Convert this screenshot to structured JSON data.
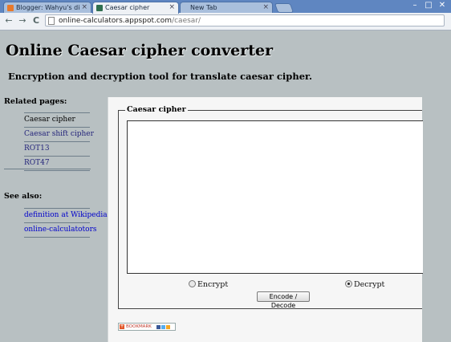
{
  "browser": {
    "tabs": [
      {
        "title": "Blogger: Wahyu's diary - I",
        "favicon_color": "#e8792b",
        "active": false
      },
      {
        "title": "Caesar cipher",
        "favicon_color": "#2f6f4f",
        "active": true
      },
      {
        "title": "New Tab",
        "favicon_color": "",
        "active": false
      }
    ],
    "tab_close_glyph": "×",
    "window_controls": {
      "minimize": "–",
      "maximize": "□",
      "close": "✕"
    },
    "nav": {
      "back": "←",
      "forward": "→",
      "reload": "C"
    },
    "url_host": "online-calculators.appspot.com",
    "url_path": "/caesar/"
  },
  "page": {
    "title": "Online Caesar cipher converter",
    "subtitle": "Encryption and decryption tool for translate caesar cipher."
  },
  "sidebar": {
    "related_heading": "Related pages:",
    "related_items": [
      {
        "label": "Caesar cipher"
      },
      {
        "label": "Caesar shift cipher"
      },
      {
        "label": "ROT13"
      },
      {
        "label": "ROT47"
      }
    ],
    "see_also_heading": "See also:",
    "see_also_items": [
      {
        "label": "definition at Wikipedia"
      },
      {
        "label": "online-calculatotors"
      }
    ]
  },
  "converter": {
    "legend": "Caesar cipher",
    "text_value": "",
    "encrypt_label": "Encrypt",
    "decrypt_label": "Decrypt",
    "selected_mode": "decrypt",
    "encode_button_label": "Encode / Decode",
    "bookmark_label": "BOOKMARK"
  },
  "colors": {
    "page_background": "#b8c0c2",
    "tabstrip": "#5f86c1",
    "panel": "#f6f6f6"
  }
}
